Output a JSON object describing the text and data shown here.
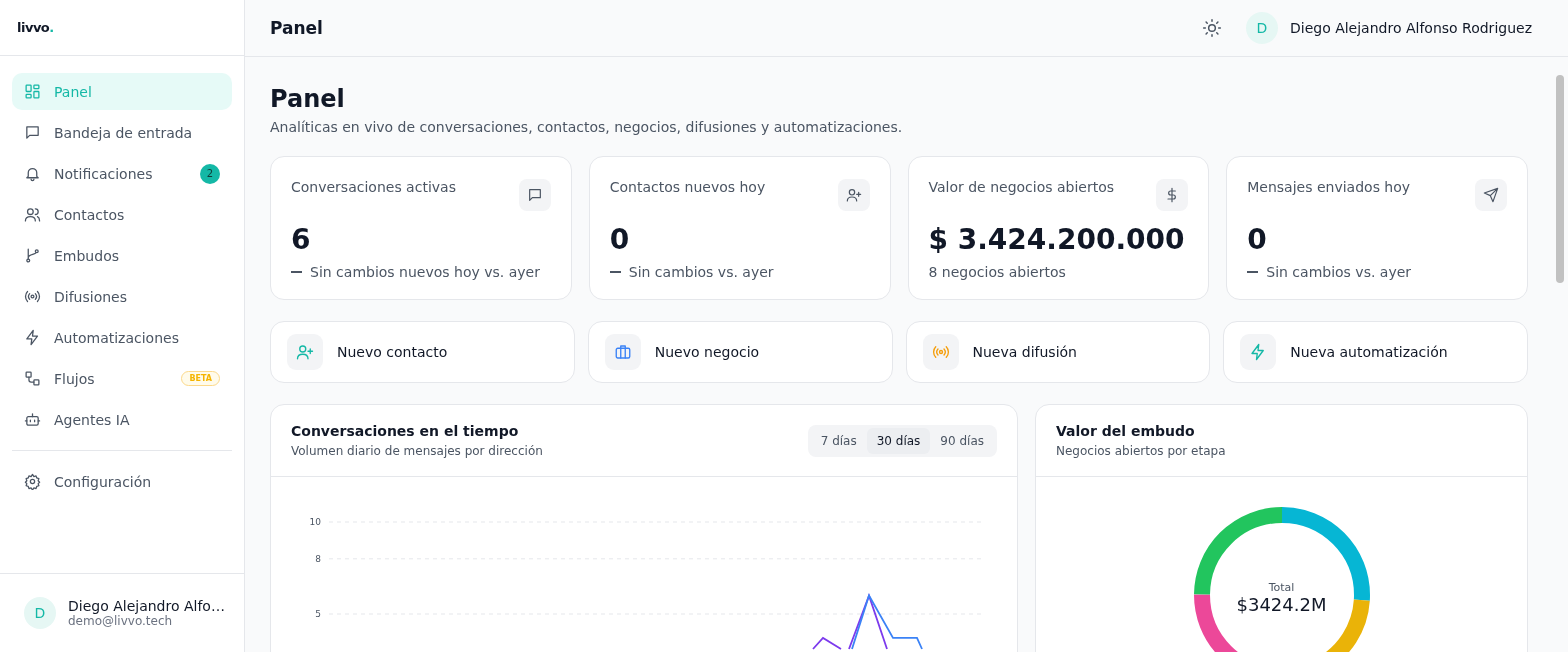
{
  "sidebar": {
    "logo": {
      "text": "livvo",
      "accent": "."
    },
    "items": [
      {
        "label": "Panel",
        "kind": "grid",
        "selected": true
      },
      {
        "label": "Bandeja de entrada",
        "kind": "message",
        "selected": false
      },
      {
        "label": "Notificaciones",
        "kind": "bell",
        "selected": false,
        "badge": "2"
      },
      {
        "label": "Contactos",
        "kind": "users",
        "selected": false
      },
      {
        "label": "Embudos",
        "kind": "branch",
        "selected": false
      },
      {
        "label": "Difusiones",
        "kind": "radio",
        "selected": false
      },
      {
        "label": "Automatizaciones",
        "kind": "bolt",
        "selected": false
      },
      {
        "label": "Flujos",
        "kind": "flow",
        "selected": false,
        "tag": "BETA"
      },
      {
        "label": "Agentes IA",
        "kind": "bot",
        "selected": false
      }
    ],
    "bottom_items": [
      {
        "label": "Configuración",
        "kind": "gear",
        "selected": false
      }
    ],
    "user": {
      "avatar": "D",
      "name": "Diego Alejandro Alfo…",
      "email": "demo@livvo.tech"
    }
  },
  "header": {
    "title": "Panel",
    "user": {
      "avatar": "D",
      "name": "Diego Alejandro Alfonso Rodriguez"
    }
  },
  "page": {
    "title": "Panel",
    "subtitle": "Analíticas en vivo de conversaciones, contactos, negocios, difusiones y automatizaciones."
  },
  "stats": [
    {
      "label": "Conversaciones activas",
      "kind": "message",
      "value": "6",
      "no_change": true,
      "note": "Sin cambios nuevos hoy vs. ayer"
    },
    {
      "label": "Contactos nuevos hoy",
      "kind": "user-plus",
      "value": "0",
      "no_change": true,
      "note": "Sin cambios vs. ayer"
    },
    {
      "label": "Valor de negocios abiertos",
      "kind": "dollar",
      "value": "$ 3.424.200.000",
      "no_change": false,
      "note": "8 negocios abiertos"
    },
    {
      "label": "Mensajes enviados hoy",
      "kind": "send",
      "value": "0",
      "no_change": true,
      "note": "Sin cambios vs. ayer"
    }
  ],
  "actions": [
    {
      "label": "Nuevo contacto",
      "kind": "user-plus",
      "color": "#14b8a6"
    },
    {
      "label": "Nuevo negocio",
      "kind": "briefcase",
      "color": "#3b82f6"
    },
    {
      "label": "Nueva difusión",
      "kind": "radio",
      "color": "#f59e0b"
    },
    {
      "label": "Nueva automatización",
      "kind": "bolt",
      "color": "#14b8a6"
    }
  ],
  "conversations_chart": {
    "title": "Conversaciones en el tiempo",
    "subtitle": "Volumen diario de mensajes por dirección",
    "ranges": [
      {
        "label": "7 días",
        "selected": false
      },
      {
        "label": "30 días",
        "selected": true
      },
      {
        "label": "90 días",
        "selected": false
      }
    ],
    "y_tick_labels": [
      "10",
      "8",
      "5"
    ]
  },
  "funnel_chart": {
    "title": "Valor del embudo",
    "subtitle": "Negocios abiertos por etapa",
    "center_label": "Total",
    "center_value": "$3424.2M"
  }
}
